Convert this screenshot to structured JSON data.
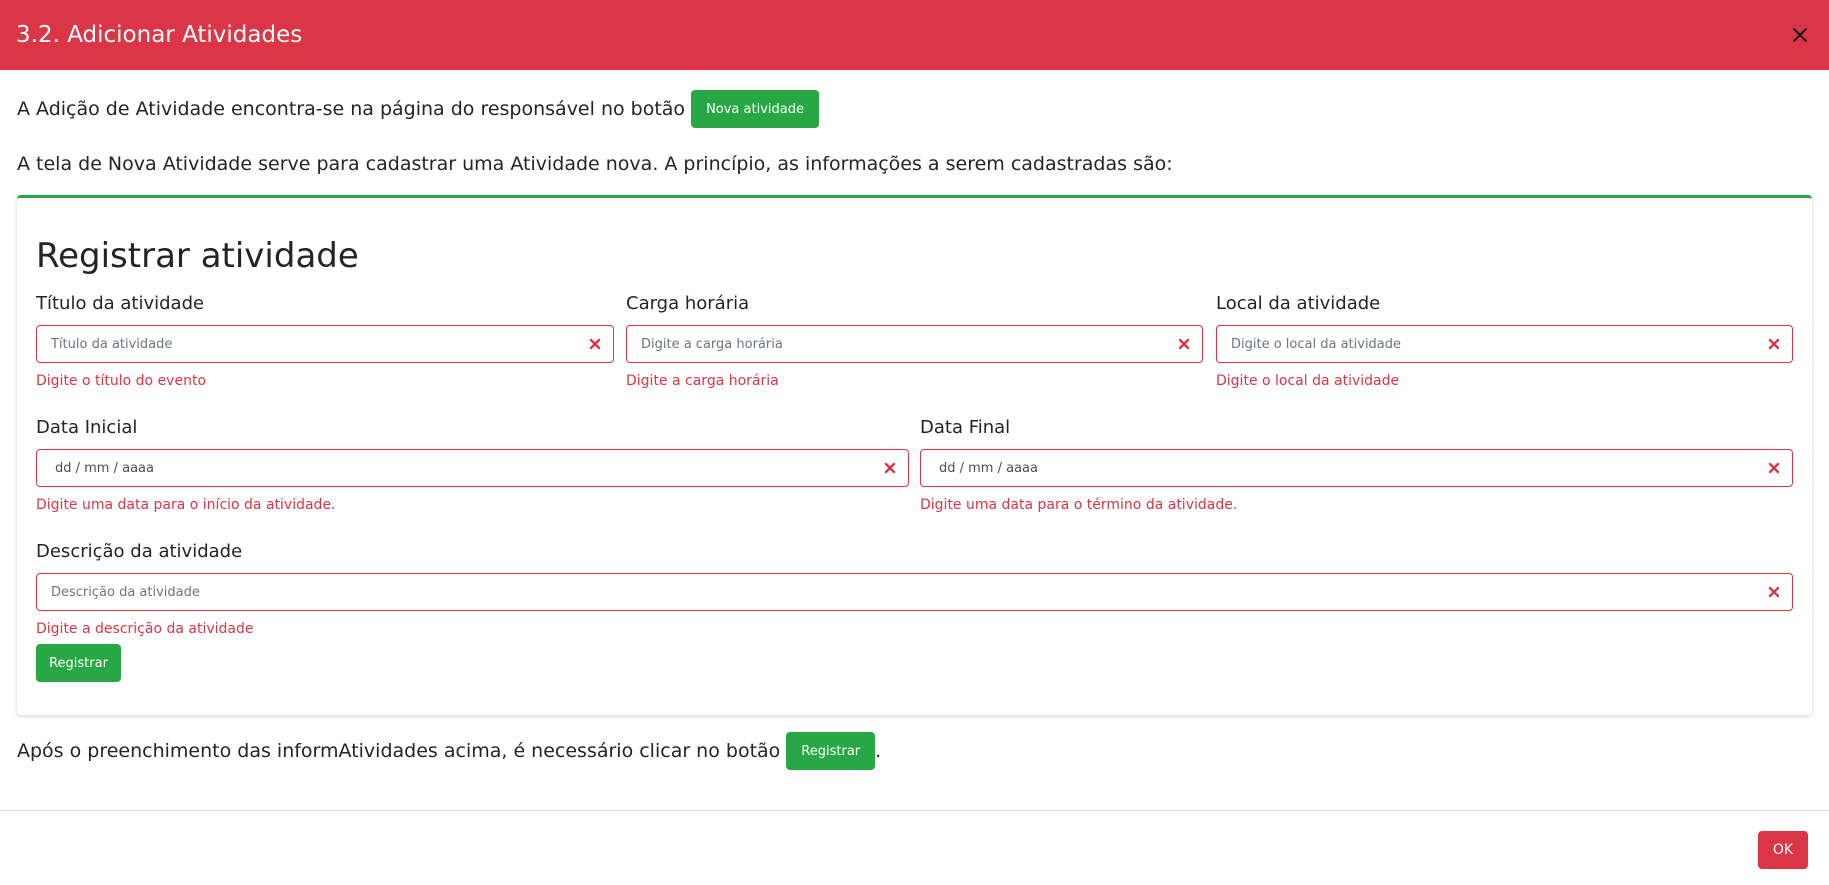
{
  "modal": {
    "title": "3.2. Adicionar Atividades",
    "ok_label": "OK"
  },
  "intro": {
    "p1_text": "A Adição de Atividade encontra-se na página do responsável no botão",
    "p1_button": "Nova atividade",
    "p2_text": "A tela de Nova Atividade serve para cadastrar uma Atividade nova. A princípio, as informações a serem cadastradas são:"
  },
  "form": {
    "title": "Registrar atividade",
    "titulo": {
      "label": "Título da atividade",
      "placeholder": "Título da atividade",
      "error": "Digite o título do evento"
    },
    "carga": {
      "label": "Carga horária",
      "placeholder": "Digite a carga horária",
      "error": "Digite a carga horária"
    },
    "local": {
      "label": "Local da atividade",
      "placeholder": "Digite o local da atividade",
      "error": "Digite o local da atividade"
    },
    "data_inicial": {
      "label": "Data Inicial",
      "placeholder": "dd / mm / aaaa",
      "error": "Digite uma data para o início da atividade."
    },
    "data_final": {
      "label": "Data Final",
      "placeholder": "dd / mm / aaaa",
      "error": "Digite uma data para o término da atividade."
    },
    "descricao": {
      "label": "Descrição da atividade",
      "placeholder": "Descrição da atividade",
      "error": "Digite a descrição da atividade"
    },
    "submit_label": "Registrar"
  },
  "footer_text": {
    "p3_text": "Após o preenchimento das informAtividades acima, é necessário clicar no botão",
    "p3_button": "Registrar",
    "p3_end": "."
  },
  "colors": {
    "header": "#dc3545",
    "success": "#28a745",
    "danger": "#dc3545"
  },
  "icons": {
    "close": "close-icon",
    "field_error": "error-x-icon"
  }
}
